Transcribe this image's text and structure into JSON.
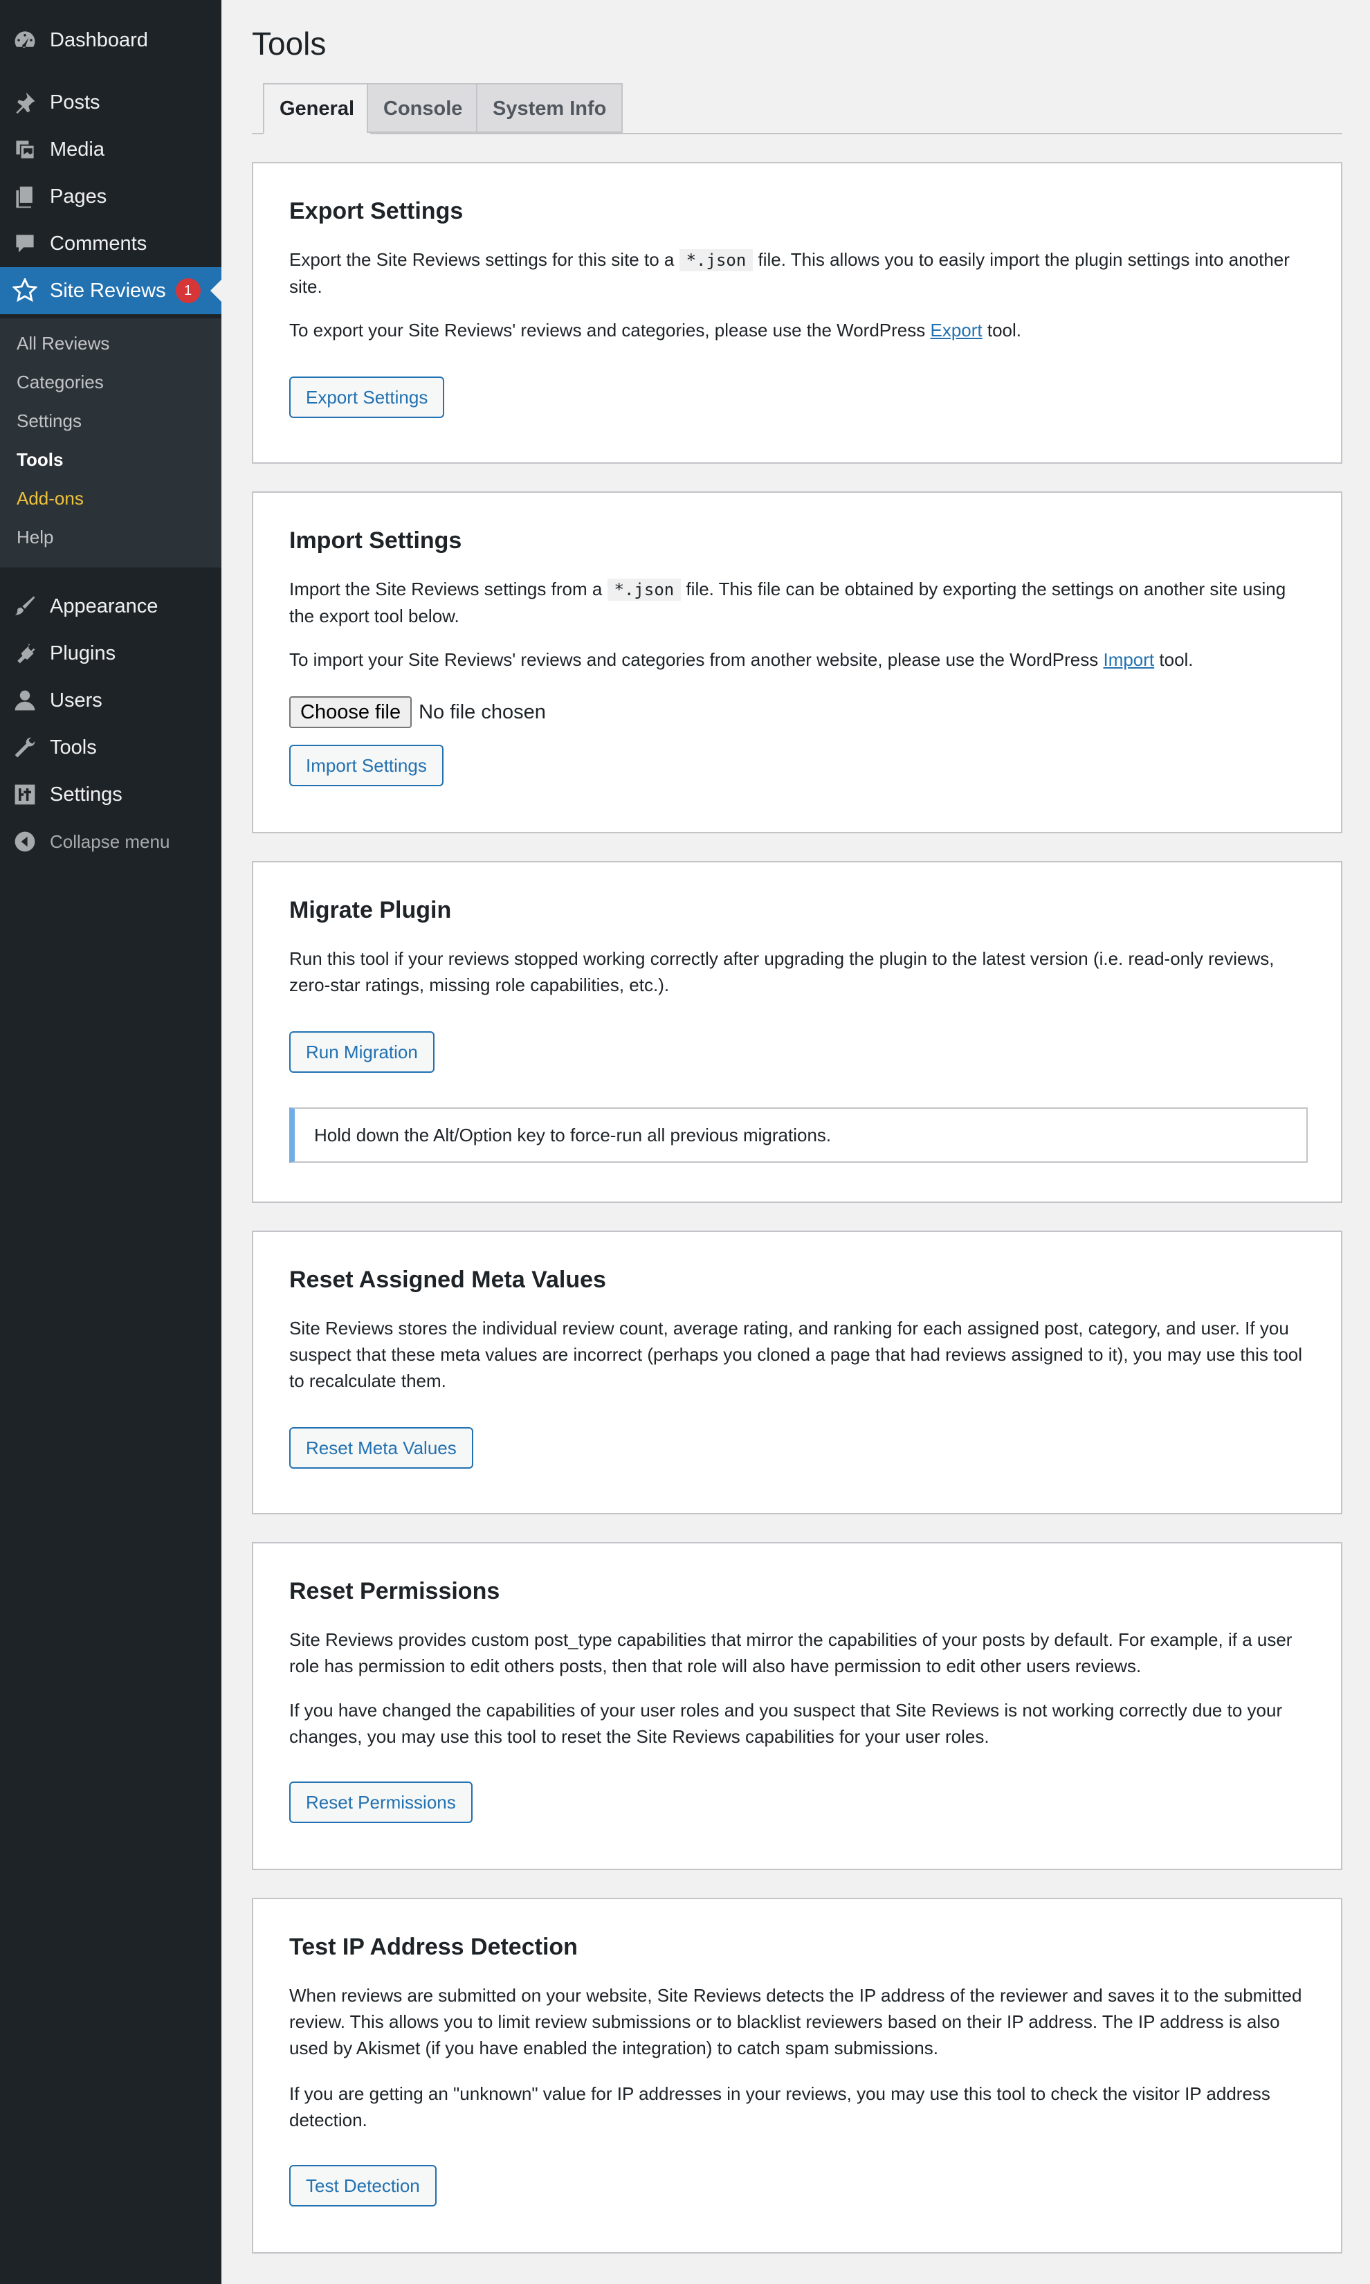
{
  "sidebar": {
    "menu": [
      {
        "label": "Dashboard",
        "icon": "dashboard-icon"
      },
      {
        "label": "Posts",
        "icon": "pin-icon"
      },
      {
        "label": "Media",
        "icon": "media-icon"
      },
      {
        "label": "Pages",
        "icon": "pages-icon"
      },
      {
        "label": "Comments",
        "icon": "comment-icon"
      },
      {
        "label": "Site Reviews",
        "icon": "star-icon",
        "badge": "1"
      },
      {
        "label": "Appearance",
        "icon": "brush-icon"
      },
      {
        "label": "Plugins",
        "icon": "plugin-icon"
      },
      {
        "label": "Users",
        "icon": "user-icon"
      },
      {
        "label": "Tools",
        "icon": "wrench-icon"
      },
      {
        "label": "Settings",
        "icon": "settings-icon"
      }
    ],
    "submenu": [
      "All Reviews",
      "Categories",
      "Settings",
      "Tools",
      "Add-ons",
      "Help"
    ],
    "collapse_label": "Collapse menu"
  },
  "page": {
    "title": "Tools",
    "tabs": [
      "General",
      "Console",
      "System Info"
    ],
    "active_tab": "General"
  },
  "cards": {
    "export": {
      "title": "Export Settings",
      "p1_before": "Export the Site Reviews settings for this site to a ",
      "p1_code": "*.json",
      "p1_after": " file. This allows you to easily import the plugin settings into another site.",
      "p2_before": "To export your Site Reviews' reviews and categories, please use the WordPress ",
      "p2_link": "Export",
      "p2_after": " tool.",
      "button": "Export Settings"
    },
    "import": {
      "title": "Import Settings",
      "p1_before": "Import the Site Reviews settings from a ",
      "p1_code": "*.json",
      "p1_after": " file. This file can be obtained by exporting the settings on another site using the export tool below.",
      "p2_before": "To import your Site Reviews' reviews and categories from another website, please use the WordPress ",
      "p2_link": "Import",
      "p2_after": " tool.",
      "file_button": "Choose file",
      "file_status": "No file chosen",
      "button": "Import Settings"
    },
    "migrate": {
      "title": "Migrate Plugin",
      "p1": "Run this tool if your reviews stopped working correctly after upgrading the plugin to the latest version (i.e. read-only reviews, zero-star ratings, missing role capabilities, etc.).",
      "button": "Run Migration",
      "notice": "Hold down the Alt/Option key to force-run all previous migrations."
    },
    "reset_meta": {
      "title": "Reset Assigned Meta Values",
      "p1": "Site Reviews stores the individual review count, average rating, and ranking for each assigned post, category, and user. If you suspect that these meta values are incorrect (perhaps you cloned a page that had reviews assigned to it), you may use this tool to recalculate them.",
      "button": "Reset Meta Values"
    },
    "reset_permissions": {
      "title": "Reset Permissions",
      "p1": "Site Reviews provides custom post_type capabilities that mirror the capabilities of your posts by default. For example, if a user role has permission to edit others posts, then that role will also have permission to edit other users reviews.",
      "p2": "If you have changed the capabilities of your user roles and you suspect that Site Reviews is not working correctly due to your changes, you may use this tool to reset the Site Reviews capabilities for your user roles.",
      "button": "Reset Permissions"
    },
    "test_ip": {
      "title": "Test IP Address Detection",
      "p1": "When reviews are submitted on your website, Site Reviews detects the IP address of the reviewer and saves it to the submitted review. This allows you to limit review submissions or to blacklist reviewers based on their IP address. The IP address is also used by Akismet (if you have enabled the integration) to catch spam submissions.",
      "p2": "If you are getting an \"unknown\" value for IP addresses in your reviews, you may use this tool to check the visitor IP address detection.",
      "button": "Test Detection"
    }
  },
  "colors": {
    "sidebar_bg": "#1d2327",
    "submenu_bg": "#2c3338",
    "accent": "#2271b1",
    "badge": "#d63638",
    "addons": "#f0c33c",
    "notice_border": "#72aee6"
  }
}
